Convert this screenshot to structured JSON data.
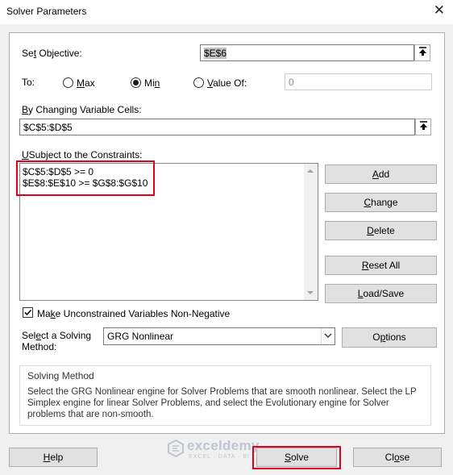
{
  "window": {
    "title": "Solver Parameters"
  },
  "objective": {
    "label_pre": "Se",
    "label_u": "t",
    "label_post": " Objective:",
    "value": "$E$6"
  },
  "to": {
    "label": "To:",
    "max": {
      "u": "M",
      "rest": "ax"
    },
    "min": {
      "pre": "Mi",
      "u": "n",
      "rest": ""
    },
    "valueof": {
      "u": "V",
      "rest": "alue Of:",
      "field": "0"
    },
    "selected": "min"
  },
  "changing": {
    "label_u": "B",
    "label_rest": "y Changing Variable Cells:",
    "value": "$C$5:$D$5"
  },
  "constraints": {
    "label_u": "U",
    "label_rest": "Subject to the Constraints:",
    "items": [
      "$C$5:$D$5 >= 0",
      "$E$8:$E$10 >= $G$8:$G$10"
    ]
  },
  "buttons": {
    "add": {
      "u": "A",
      "rest": "dd"
    },
    "change": {
      "u": "C",
      "rest": "hange"
    },
    "delete": {
      "u": "D",
      "rest": "elete"
    },
    "reset": {
      "u": "R",
      "rest": "eset All"
    },
    "loadsave": {
      "u": "L",
      "rest": "oad/Save"
    },
    "options": {
      "pre": "O",
      "u": "p",
      "rest": "tions"
    },
    "help": {
      "u": "H",
      "rest": "elp"
    },
    "solve": {
      "u": "S",
      "rest": "olve"
    },
    "close": {
      "pre": "Cl",
      "u": "o",
      "rest": "se"
    }
  },
  "nonneg": {
    "pre": "Ma",
    "u": "k",
    "rest": "e Unconstrained Variables Non-Negative",
    "checked": true
  },
  "method": {
    "label_line1_pre": "Sel",
    "label_line1_u": "e",
    "label_line1_rest": "ct a Solving",
    "label_line2": "Method:",
    "selected": "GRG Nonlinear"
  },
  "method_box": {
    "title": "Solving Method",
    "description": "Select the GRG Nonlinear engine for Solver Problems that are smooth nonlinear. Select the LP Simplex engine for linear Solver Problems, and select the Evolutionary engine for Solver problems that are non-smooth."
  },
  "watermark": {
    "name": "exceldemy",
    "tagline": "EXCEL · DATA · BI"
  },
  "colors": {
    "highlight": "#e0001b",
    "button_face": "#e1e1e1",
    "selection": "#c2c2c2"
  }
}
